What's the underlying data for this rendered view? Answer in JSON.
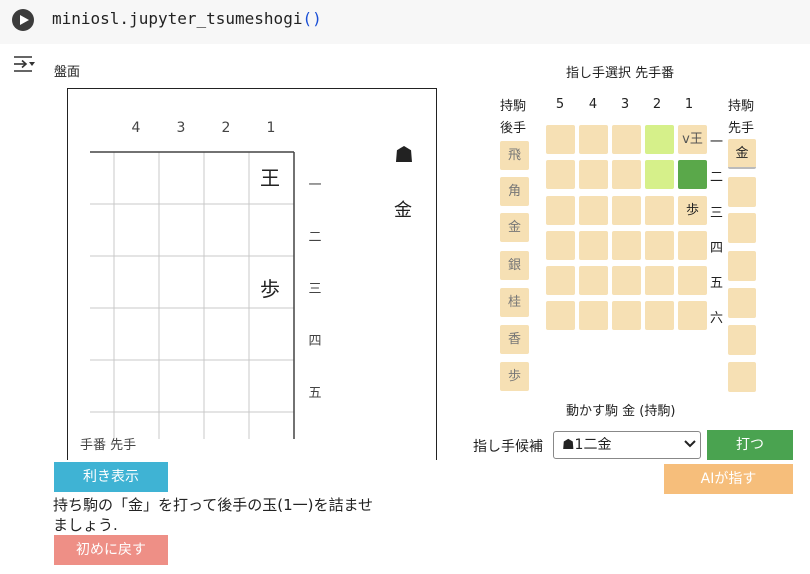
{
  "code": {
    "call": "miniosl.jupyter_tsumeshogi",
    "parens": "()"
  },
  "board": {
    "label": "盤面",
    "col_numbers": [
      "4",
      "3",
      "2",
      "1"
    ],
    "row_kanji": [
      "一",
      "二",
      "三",
      "四",
      "五"
    ],
    "pieces": {
      "king": "王",
      "pawn": "歩"
    },
    "sente_mark": "☗",
    "sente_hand_piece": "金",
    "turn_label": "手番 先手"
  },
  "buttons": {
    "show_attacks": "利き表示",
    "reset": "初めに戻す",
    "play": "打つ",
    "ai_move": "AIが指す"
  },
  "colors": {
    "show_attacks_bg": "#3fb3d4",
    "reset_bg": "#ee8f86",
    "play_bg": "#4aa350",
    "ai_bg": "#f6be7b",
    "cell": "#f6e0b4"
  },
  "problem_text_line1": "持ち駒の「金」を打って後手の玉(1一)を詰ませ",
  "problem_text_line2": "ましょう.",
  "selector": {
    "title": "指し手選択 先手番",
    "gote_hand_label1": "持駒",
    "gote_hand_label2": "後手",
    "gote_hand_pieces": [
      "飛",
      "角",
      "金",
      "銀",
      "桂",
      "香",
      "歩"
    ],
    "col_numbers": [
      "5",
      "4",
      "3",
      "2",
      "1"
    ],
    "row_kanji": [
      "一",
      "二",
      "三",
      "四",
      "五",
      "六"
    ],
    "gote_king_text": "v王",
    "pawn_text": "歩",
    "sente_hand_label1": "持駒",
    "sente_hand_label2": "先手",
    "sente_hand_piece": "金",
    "moving_piece_label": "動かす駒 金 (持駒)",
    "candidate_label": "指し手候補",
    "candidate_value": "☗1二金"
  }
}
